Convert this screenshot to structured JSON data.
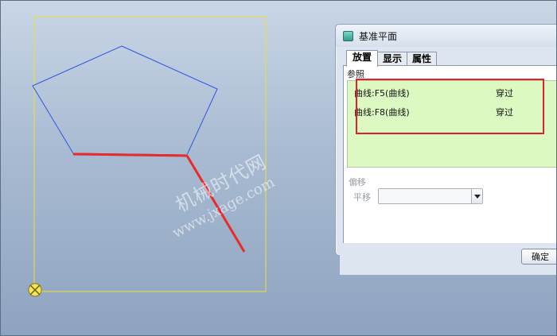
{
  "dialog": {
    "title": "基准平面",
    "tabs": [
      {
        "label": "放置",
        "active": true
      },
      {
        "label": "显示",
        "active": false
      },
      {
        "label": "属性",
        "active": false
      }
    ],
    "references_label": "参照",
    "references": [
      {
        "name": "曲线:F5(曲线)",
        "type": "穿过"
      },
      {
        "name": "曲线:F8(曲线)",
        "type": "穿过"
      }
    ],
    "offset_label": "偏移",
    "translate_label": "平移",
    "translate_value": "",
    "ok_label": "确定"
  },
  "watermark": {
    "title": "机械时代网",
    "url": "www.jxage.com"
  },
  "colors": {
    "sketch_frame": "#e8e23a",
    "pentagon": "#2f55e6",
    "selected_curve": "#e82a2a",
    "highlight_box": "#e0202a",
    "reference_bg": "#dcf9c2"
  }
}
